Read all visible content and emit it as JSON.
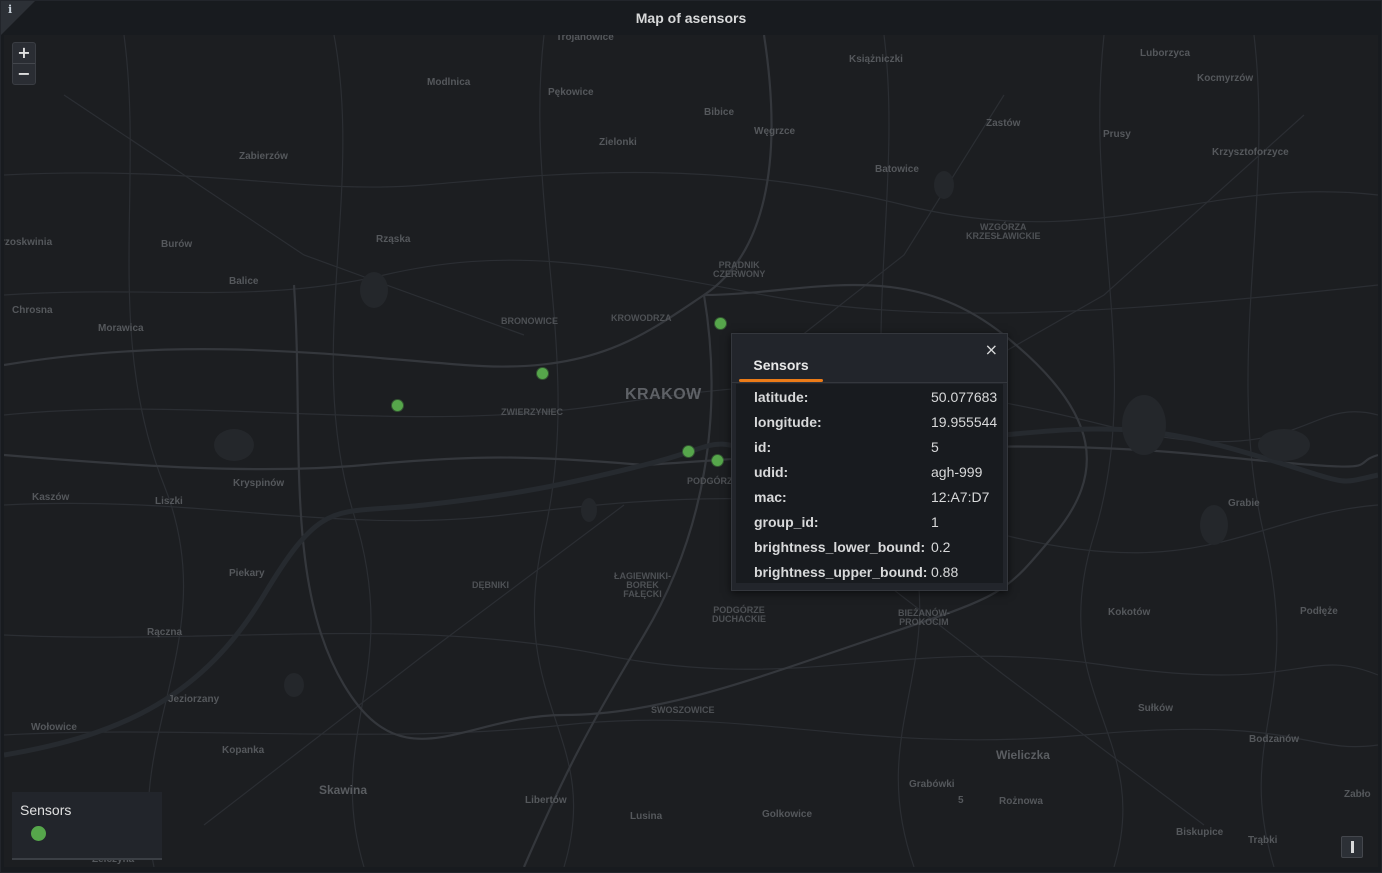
{
  "panel": {
    "title": "Map of asensors",
    "info_glyph": "i"
  },
  "map": {
    "zoom_in_label": "+",
    "zoom_out_label": "−",
    "places": {
      "trojanowice": "Trojanowice",
      "ksiazniczki": "Książniczki",
      "luborzyca": "Luborzyca",
      "kocmyrzow": "Kocmyrzów",
      "modlnica": "Modlnica",
      "pekowice": "Pękowice",
      "bibice": "Bibice",
      "wegrzce": "Węgrzce",
      "zastow": "Zastów",
      "prusy": "Prusy",
      "zielonki": "Zielonki",
      "zabierzow": "Zabierzów",
      "krzysztoforzyce": "Krzysztoforzyce",
      "batowice": "Batowice",
      "rzaska": "Rząska",
      "burow": "Burów",
      "brzoskwinia": "rzoskwinia",
      "wzgorza": "WZGÓRZA\nKRZESŁAWICKIE",
      "pradnik": "PRĄDNIK\nCZERWONY",
      "balice": "Balice",
      "chrosna": "Chrosna",
      "morawica": "Morawica",
      "bronowice": "BRONOWICE",
      "krowodrza": "KROWODRZA",
      "krakow": "KRAKOW",
      "zwierzyniec": "ZWIERZYNIEC",
      "kryspinow": "Kryspinów",
      "kaszow": "Kaszów",
      "liszki": "Liszki",
      "podgorze": "PODGÓRZ",
      "grabie": "Grabie",
      "piekary": "Piekary",
      "debniki": "DĘBNIKI",
      "lagiewniki": "ŁAGIEWNIKI-\nBOREK\nFAŁĘCKI",
      "podgorze_duchackie": "PODGÓRZE\nDUCHACKIE",
      "bierzanow": "BIEŻANÓW-\nPROKOCIM",
      "kokotow": "Kokotów",
      "podleze": "Podłęże",
      "raczna": "Rączna",
      "jeziorzany": "Jeziorzany",
      "swoszowice": "SWOSZOWICE",
      "sulkow": "Sułków",
      "wolowice": "Wołowice",
      "bodzanow": "Bodzanów",
      "kopanka": "Kopanka",
      "wieliczka": "Wieliczka",
      "skawina": "Skawina",
      "grabowki": "Grabówki",
      "libertow": "Libertów",
      "roznowa": "Rożnowa",
      "zablocie": "Zabło",
      "lusina": "Lusina",
      "golkowice": "Golkowice",
      "biskupice": "Biskupice",
      "trabki": "Trąbki",
      "zelczyna": "Zelczyna",
      "route5": "5"
    },
    "marker_color": "#56a64b",
    "marker_count": 5
  },
  "popup": {
    "tab": "Sensors",
    "close": "×",
    "accent": "#eb7b18",
    "fields": [
      {
        "key": "latitude:",
        "value": "50.077683"
      },
      {
        "key": "longitude:",
        "value": "19.955544"
      },
      {
        "key": "id:",
        "value": "5"
      },
      {
        "key": "udid:",
        "value": "agh-999"
      },
      {
        "key": "mac:",
        "value": "12:A7:D7"
      },
      {
        "key": "group_id:",
        "value": "1"
      },
      {
        "key": "brightness_lower_bound:",
        "value": "0.2"
      },
      {
        "key": "brightness_upper_bound:",
        "value": "0.88"
      }
    ]
  },
  "legend": {
    "title": "Sensors",
    "color": "#56a64b"
  }
}
